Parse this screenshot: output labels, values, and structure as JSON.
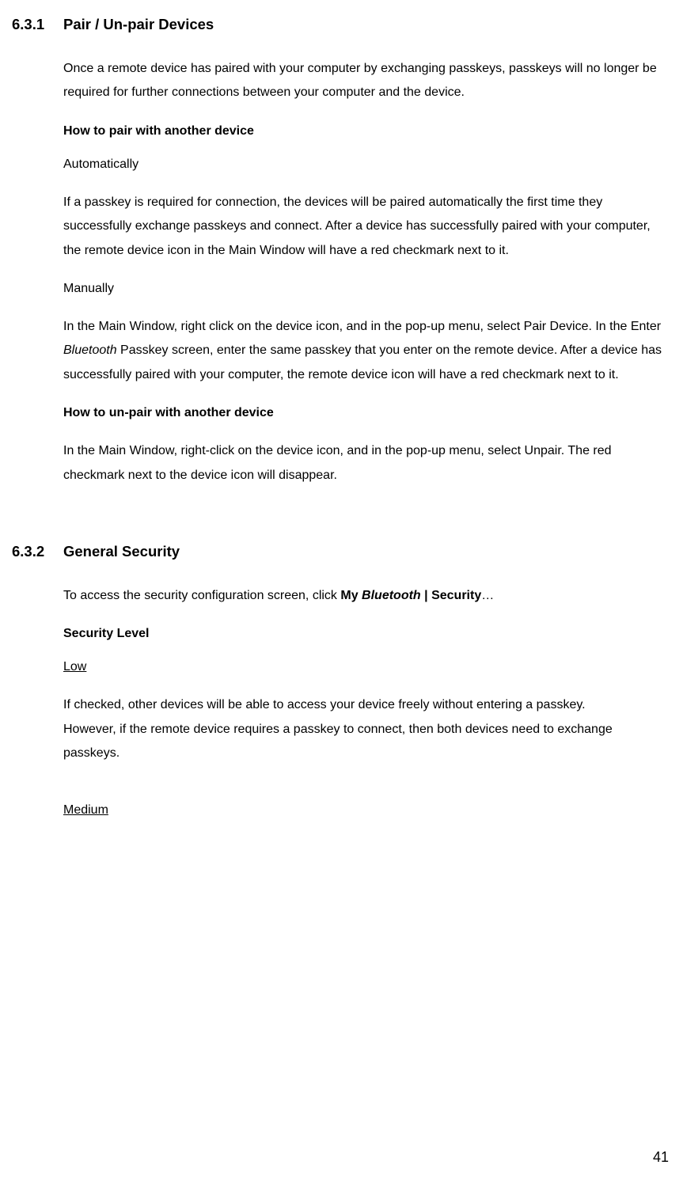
{
  "section1": {
    "number": "6.3.1",
    "title": "Pair / Un-pair Devices",
    "intro": "Once a remote device has paired with your computer by exchanging passkeys, passkeys will no longer be required for further connections between your computer and the device.",
    "how_pair_heading": "How to pair with another device",
    "auto_label": "Automatically",
    "auto_text": "If a passkey is required for connection, the devices will be paired automatically the first time they successfully exchange passkeys and connect. After a device has successfully paired with your computer, the remote device icon in the Main Window will have a red checkmark next to it.",
    "manual_label": "Manually",
    "manual_text_pre": "In the Main Window, right click on the device icon, and in the pop-up menu, select Pair Device. In the Enter ",
    "manual_text_italic": "Bluetooth",
    "manual_text_post": " Passkey screen, enter the same passkey that you enter on the remote device. After a device has successfully paired with your computer, the remote device icon will have a red checkmark next to it.",
    "how_unpair_heading": "How to un-pair with another device",
    "unpair_text": "In the Main Window, right-click on the device icon, and in the pop-up menu, select Unpair. The red checkmark next to the device icon will disappear."
  },
  "section2": {
    "number": "6.3.2",
    "title": "General Security",
    "intro_pre": "To access the security configuration screen, click ",
    "intro_bold1": "My ",
    "intro_bolditalic": "Bluetooth",
    "intro_bold2": " | Security",
    "intro_post": "…",
    "sec_level_heading": "Security Level",
    "low_label": "Low",
    "low_text_line1": "If checked, other devices will be able to access your device freely without entering a passkey.",
    "low_text_line2": "However, if the remote device requires a passkey to connect, then both devices need to exchange passkeys.",
    "medium_label": "Medium"
  },
  "page_number": "41"
}
